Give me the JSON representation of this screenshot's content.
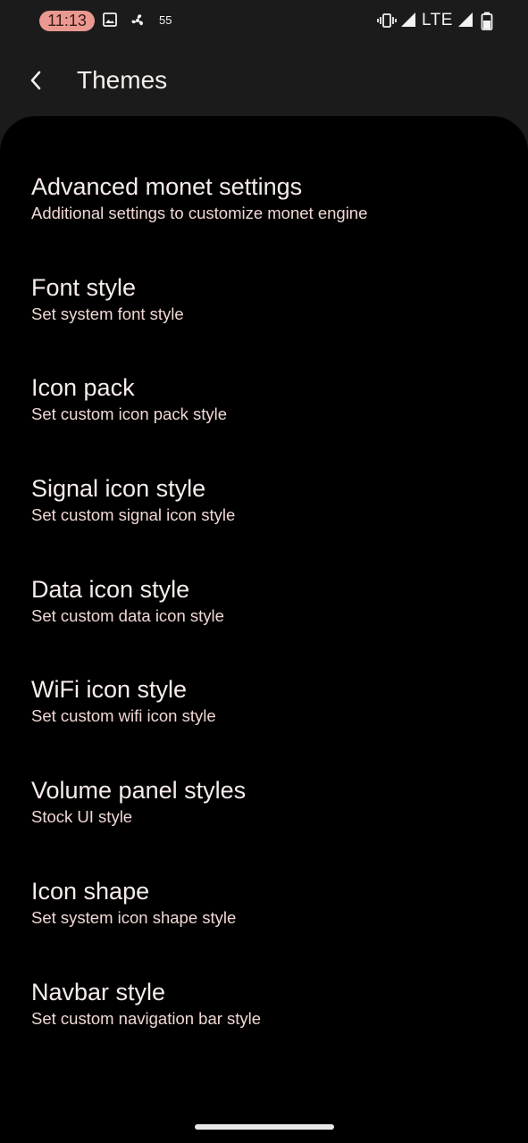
{
  "status_bar": {
    "time": "11:13",
    "notification_count": "55",
    "network": "LTE",
    "icons": [
      "image-icon",
      "wind-fan-icon",
      "vibrate-icon",
      "signal-icon",
      "lte-signal-icon",
      "battery-icon"
    ]
  },
  "header": {
    "title": "Themes",
    "back_icon": "chevron-left-icon"
  },
  "settings": [
    {
      "title": "Advanced monet settings",
      "summary": "Additional settings to customize monet engine"
    },
    {
      "title": "Font style",
      "summary": "Set system font style"
    },
    {
      "title": "Icon pack",
      "summary": "Set custom icon pack style"
    },
    {
      "title": "Signal icon style",
      "summary": "Set custom signal icon style"
    },
    {
      "title": "Data icon style",
      "summary": "Set custom data icon style"
    },
    {
      "title": "WiFi icon style",
      "summary": "Set custom wifi icon style"
    },
    {
      "title": "Volume panel styles",
      "summary": "Stock UI style"
    },
    {
      "title": "Icon shape",
      "summary": "Set system icon shape style"
    },
    {
      "title": "Navbar style",
      "summary": "Set custom navigation bar style"
    }
  ],
  "colors": {
    "accent": "#ea9990",
    "background": "#000000",
    "header_background": "#1b1b1b",
    "title_text": "#f6ecea",
    "summary_text": "#f0d8d4"
  }
}
